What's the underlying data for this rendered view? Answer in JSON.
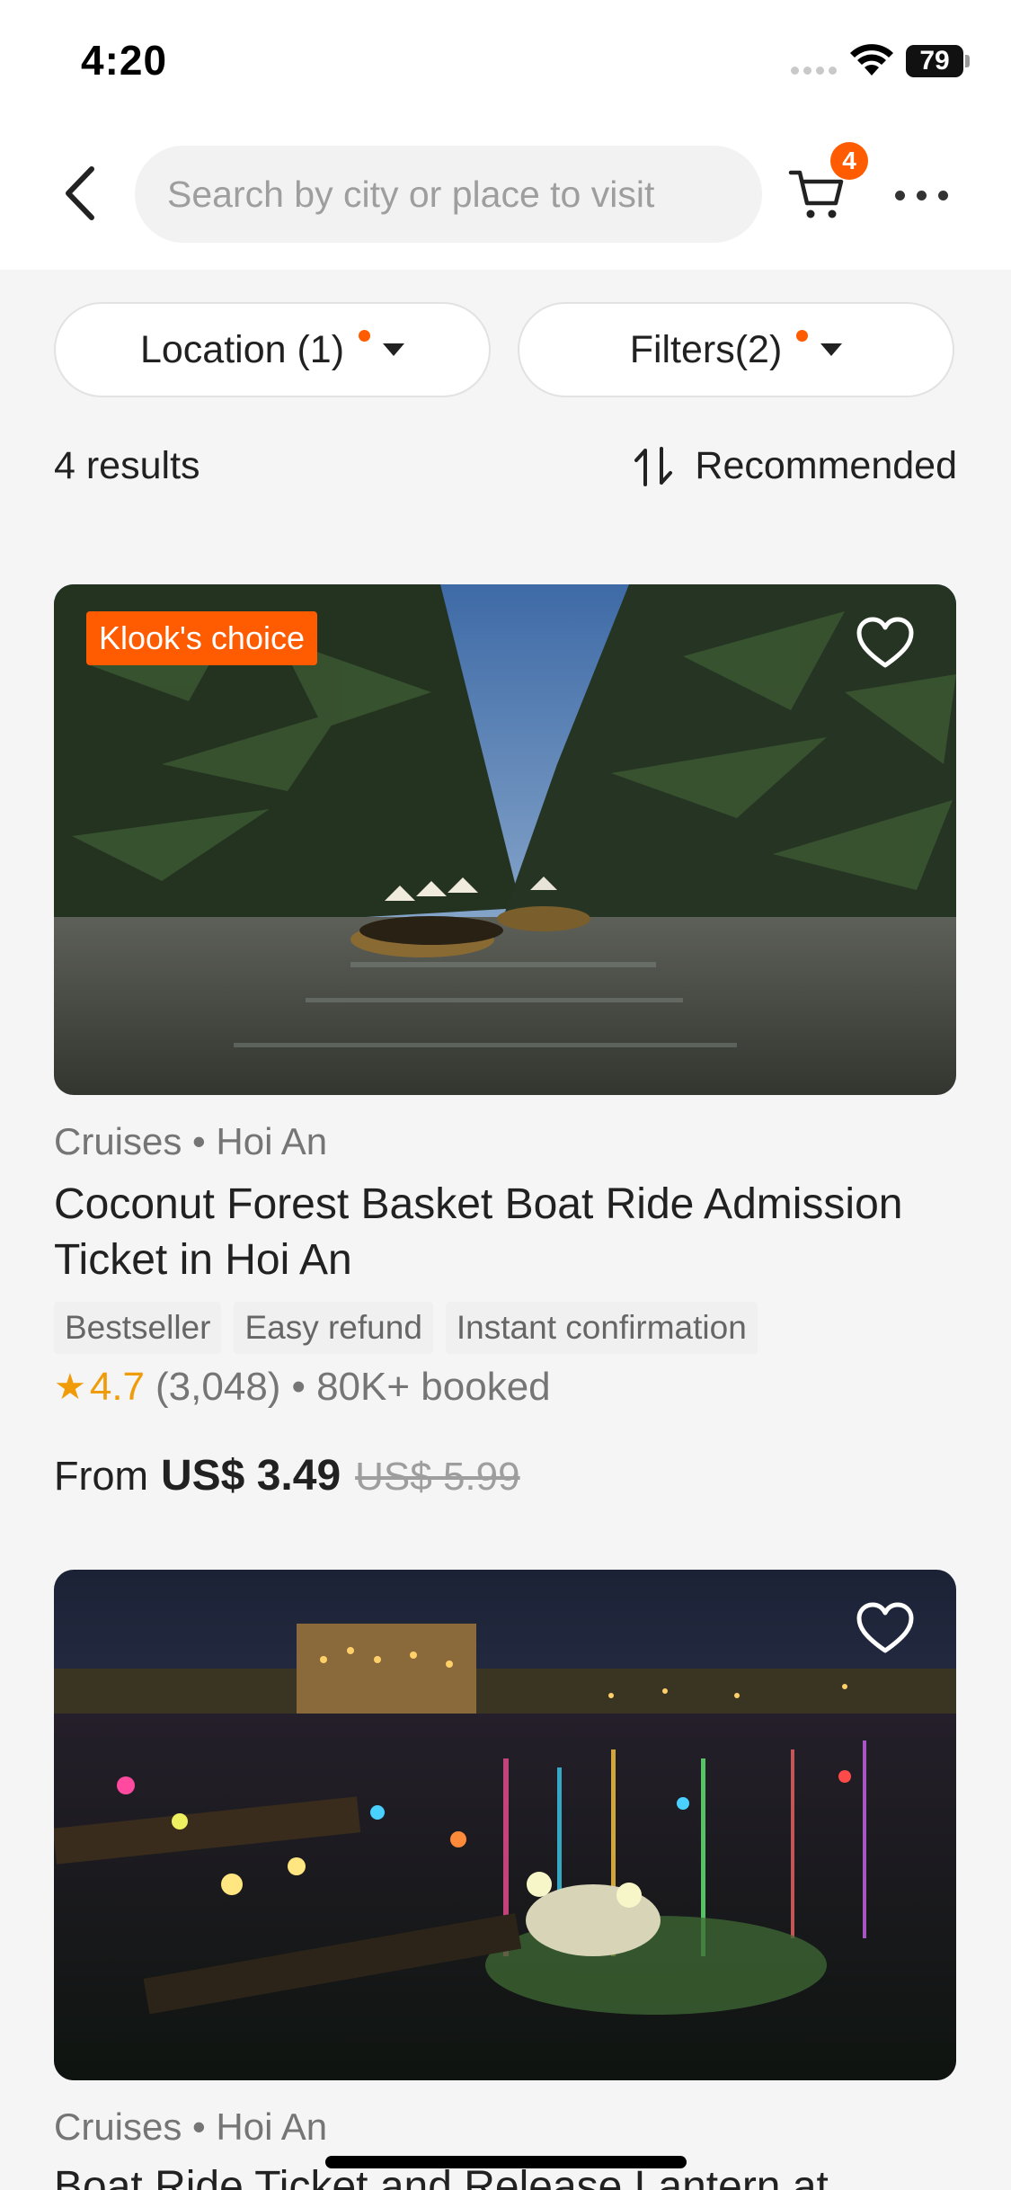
{
  "status": {
    "time": "4:20",
    "battery": "79"
  },
  "search": {
    "placeholder": "Search by city or place to visit"
  },
  "cart": {
    "count": "4"
  },
  "filters": {
    "location_label": "Location (1)",
    "filters_label": "Filters(2)"
  },
  "results": {
    "count_label": "4 results",
    "sort_label": "Recommended"
  },
  "cards": [
    {
      "badge": "Klook's choice",
      "meta": "Cruises • Hoi An",
      "title": "Coconut Forest Basket Boat Ride Admission Ticket in Hoi An",
      "tags": [
        "Bestseller",
        "Easy refund",
        "Instant confirmation"
      ],
      "rating": "4.7",
      "reviews": "(3,048)",
      "booked": "• 80K+ booked",
      "price_prefix": "From",
      "price": "US$ 3.49",
      "old_price": "US$ 5.99"
    },
    {
      "meta": "Cruises • Hoi An",
      "title": "Boat Ride Ticket and Release Lantern at"
    }
  ],
  "colors": {
    "accent": "#ff5b00",
    "star": "#f09b0a"
  },
  "icons": [
    "back-arrow-icon",
    "cart-icon",
    "more-icon",
    "sort-icon",
    "heart-icon",
    "star-icon",
    "wifi-icon"
  ]
}
